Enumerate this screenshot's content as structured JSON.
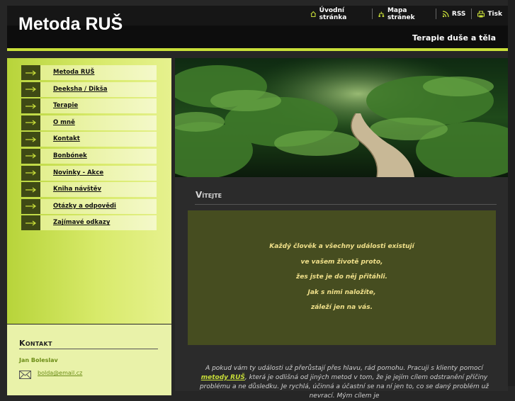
{
  "header": {
    "site_title": "Metoda RUŠ",
    "tagline": "Terapie duše a těla",
    "nav": [
      {
        "label": "Úvodní stránka",
        "icon": "home-icon"
      },
      {
        "label": "Mapa stránek",
        "icon": "sitemap-icon"
      },
      {
        "label": "RSS",
        "icon": "rss-icon"
      },
      {
        "label": "Tisk",
        "icon": "print-icon"
      }
    ]
  },
  "sidebar": {
    "menu": [
      {
        "label": "Metoda RUŠ"
      },
      {
        "label": "Deeksha / Dikša"
      },
      {
        "label": "Terapie"
      },
      {
        "label": "O mně"
      },
      {
        "label": "Kontakt"
      },
      {
        "label": "Bonbónek"
      },
      {
        "label": "Novinky - Akce"
      },
      {
        "label": "Kniha návštěv"
      },
      {
        "label": "Otázky a odpovědi"
      },
      {
        "label": "Zajímavé odkazy"
      }
    ],
    "contact": {
      "title": "Kontakt",
      "name": "Jan Boleslav",
      "email": "bolda@email.cz",
      "email_icon": "mail-icon"
    }
  },
  "main": {
    "hero_image": "forest-boardwalk-photo",
    "heading": "Vítejte",
    "quote_lines": [
      "Každý člověk a všechny události existují",
      "ve vašem životě proto,",
      "žes jste je do něj přitáhli.",
      "Jak s nimi naložíte,",
      "záleží jen na vás."
    ],
    "body_pre": "A pokud vám ty události už přerůstají přes hlavu, rád pomohu. Pracuji s klienty pomocí ",
    "body_link": "metody RUŠ",
    "body_post": ", která je odlišná od jiných metod v tom, že je jejím cílem odstranění příčiny problému a ne důsledku. Je rychlá, účinná a účastní se na ní jen to, co se daný problém už nevrací. Mým cílem je"
  },
  "colors": {
    "accent": "#c9df39",
    "quote_bg": "#464d20",
    "quote_text": "#f0e08a",
    "menu_arrow_bg": "#3f4a15"
  }
}
